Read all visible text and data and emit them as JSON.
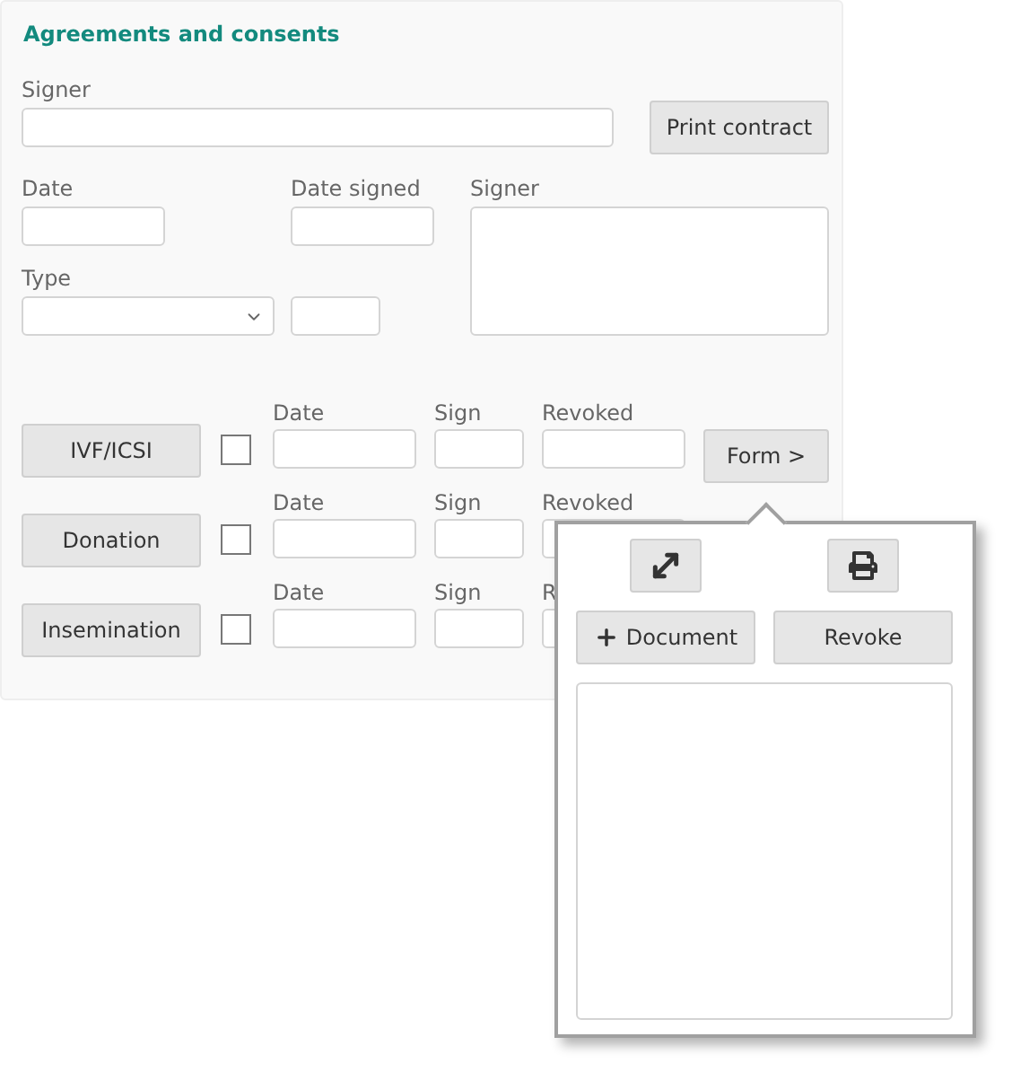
{
  "section": {
    "title": "Agreements and consents"
  },
  "signer": {
    "label": "Signer"
  },
  "print_button": "Print contract",
  "date": {
    "label": "Date"
  },
  "date_signed": {
    "label": "Date signed"
  },
  "signer_notes": {
    "label": "Signer"
  },
  "type": {
    "label": "Type"
  },
  "consents": [
    {
      "button": "IVF/ICSI",
      "checked": false,
      "date_label": "Date",
      "sign_label": "Sign",
      "revoked_label": "Revoked",
      "form_button": "Form >"
    },
    {
      "button": "Donation",
      "checked": false,
      "date_label": "Date",
      "sign_label": "Sign",
      "revoked_label": "Revoked"
    },
    {
      "button": "Insemination",
      "checked": false,
      "date_label": "Date",
      "sign_label": "Sign",
      "revoked_label": "R"
    }
  ],
  "popup": {
    "document_button": "Document",
    "revoke_button": "Revoke"
  }
}
